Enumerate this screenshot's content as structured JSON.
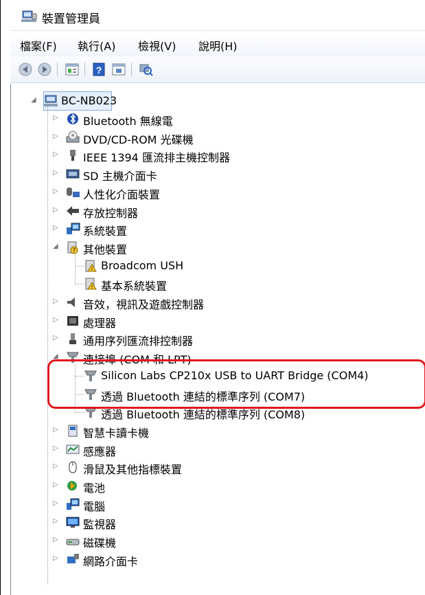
{
  "window": {
    "title": "裝置管理員",
    "title_icon": "device-manager-icon"
  },
  "menu": [
    "檔案(F)",
    "執行(A)",
    "檢視(V)",
    "說明(H)"
  ],
  "toolbar": [
    {
      "name": "back-icon"
    },
    {
      "name": "forward-icon"
    },
    {
      "name": "properties-icon"
    },
    {
      "name": "help-icon"
    },
    {
      "name": "view-icon"
    },
    {
      "name": "scan-hardware-icon"
    }
  ],
  "tree": {
    "root": "BC-NB023",
    "items": [
      {
        "label": "Bluetooth 無線電",
        "icon": "bluetooth-icon",
        "expanded": false
      },
      {
        "label": "DVD/CD-ROM 光碟機",
        "icon": "dvd-drive-icon",
        "expanded": false
      },
      {
        "label": "IEEE 1394 匯流排主機控制器",
        "icon": "ieee1394-icon",
        "expanded": false
      },
      {
        "label": "SD 主機介面卡",
        "icon": "sd-card-icon",
        "expanded": false
      },
      {
        "label": "人性化介面裝置",
        "icon": "hid-icon",
        "expanded": false
      },
      {
        "label": "存放控制器",
        "icon": "storage-controller-icon",
        "expanded": false
      },
      {
        "label": "系統裝置",
        "icon": "system-device-icon",
        "expanded": false
      },
      {
        "label": "其他裝置",
        "icon": "other-device-icon",
        "expanded": true,
        "children": [
          "Broadcom USH",
          "基本系統裝置"
        ]
      },
      {
        "label": "音效，視訊及遊戲控制器",
        "icon": "audio-icon",
        "expanded": false
      },
      {
        "label": "處理器",
        "icon": "processor-icon",
        "expanded": false
      },
      {
        "label": "通用序列匯流排控制器",
        "icon": "usb-icon",
        "expanded": false
      },
      {
        "label": "連接埠 (COM 和 LPT)",
        "icon": "port-icon",
        "expanded": true,
        "children": [
          "Silicon Labs CP210x USB to UART Bridge (COM4)",
          "透過 Bluetooth 連結的標準序列 (COM7)",
          "透過 Bluetooth 連結的標準序列 (COM8)"
        ]
      },
      {
        "label": "智慧卡讀卡機",
        "icon": "smartcard-icon",
        "expanded": false
      },
      {
        "label": "感應器",
        "icon": "sensor-icon",
        "expanded": false
      },
      {
        "label": "滑鼠及其他指標裝置",
        "icon": "mouse-icon",
        "expanded": false
      },
      {
        "label": "電池",
        "icon": "battery-icon",
        "expanded": false
      },
      {
        "label": "電腦",
        "icon": "computer-icon",
        "expanded": false
      },
      {
        "label": "監視器",
        "icon": "monitor-icon",
        "expanded": false
      },
      {
        "label": "磁碟機",
        "icon": "disk-drive-icon",
        "expanded": false
      },
      {
        "label": "網路介面卡",
        "icon": "network-adapter-icon",
        "expanded": false
      }
    ]
  },
  "colors": {
    "highlight": "#e0161e",
    "selection": "#e6f0fb"
  }
}
